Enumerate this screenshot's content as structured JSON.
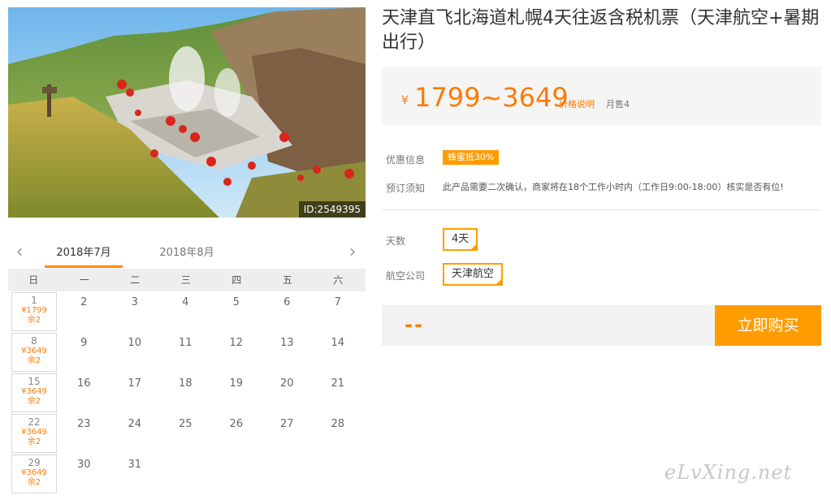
{
  "photo": {
    "id_label": "ID:2549395"
  },
  "title": "天津直飞北海道札幌4天往返含税机票（天津航空+暑期出行）",
  "price": {
    "currency": "¥",
    "range": "1799~3649",
    "explain_link": "价格说明",
    "monthly_sales": "月售4"
  },
  "promo": {
    "label": "优惠信息",
    "badge": "蜂蜜抵30%"
  },
  "booking_notice": {
    "label": "预订须知",
    "text": "此产品需要二次确认，商家将在18个工作小时内（工作日9:00-18:00）核实是否有位!"
  },
  "options": {
    "days": {
      "label": "天数",
      "value": "4天"
    },
    "airline": {
      "label": "航空公司",
      "value": "天津航空"
    }
  },
  "buy": {
    "total": "--",
    "button": "立即购买"
  },
  "calendar": {
    "tabs": [
      "2018年7月",
      "2018年8月"
    ],
    "weekdays": [
      "日",
      "一",
      "二",
      "三",
      "四",
      "五",
      "六"
    ],
    "rows": [
      [
        {
          "d": "1",
          "p": "¥1799",
          "r": "余2"
        },
        {
          "d": "2"
        },
        {
          "d": "3"
        },
        {
          "d": "4"
        },
        {
          "d": "5"
        },
        {
          "d": "6"
        },
        {
          "d": "7"
        }
      ],
      [
        {
          "d": "8",
          "p": "¥3649",
          "r": "余2"
        },
        {
          "d": "9"
        },
        {
          "d": "10"
        },
        {
          "d": "11"
        },
        {
          "d": "12"
        },
        {
          "d": "13"
        },
        {
          "d": "14"
        }
      ],
      [
        {
          "d": "15",
          "p": "¥3649",
          "r": "余2"
        },
        {
          "d": "16"
        },
        {
          "d": "17"
        },
        {
          "d": "18"
        },
        {
          "d": "19"
        },
        {
          "d": "20"
        },
        {
          "d": "21"
        }
      ],
      [
        {
          "d": "22",
          "p": "¥3649",
          "r": "余2"
        },
        {
          "d": "23"
        },
        {
          "d": "24"
        },
        {
          "d": "25"
        },
        {
          "d": "26"
        },
        {
          "d": "27"
        },
        {
          "d": "28"
        }
      ],
      [
        {
          "d": "29",
          "p": "¥3649",
          "r": "余2"
        },
        {
          "d": "30"
        },
        {
          "d": "31"
        }
      ]
    ]
  },
  "watermark": "eLvXing.net"
}
